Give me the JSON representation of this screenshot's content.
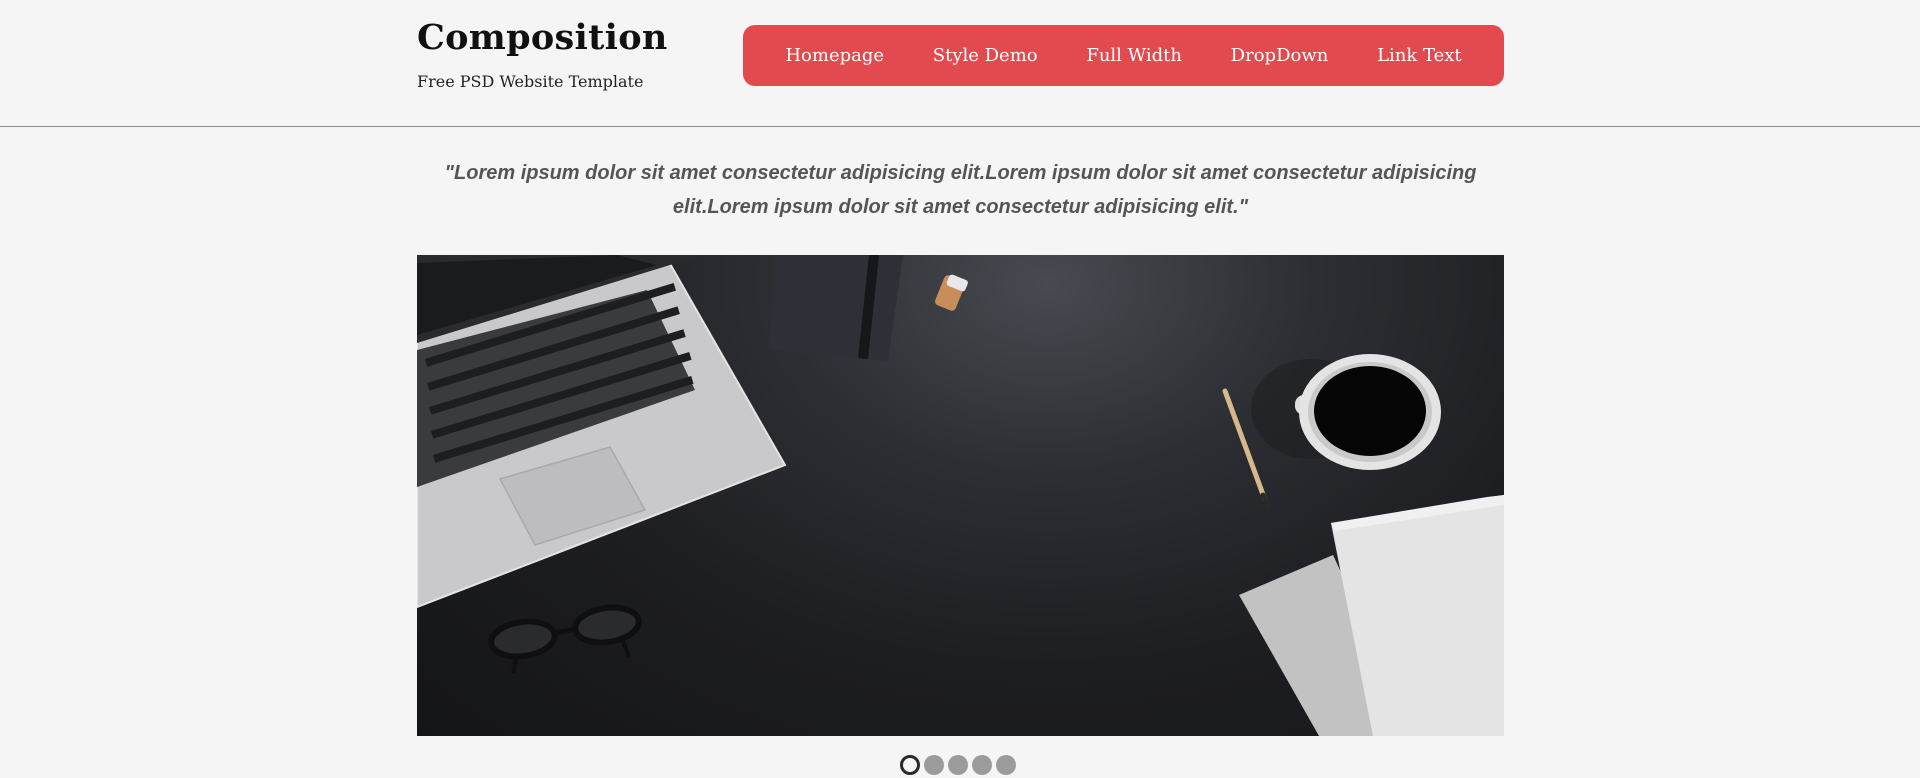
{
  "header": {
    "title": "Composition",
    "tagline": "Free PSD Website Template"
  },
  "nav": {
    "items": [
      {
        "label": "Homepage"
      },
      {
        "label": "Style Demo"
      },
      {
        "label": "Full Width"
      },
      {
        "label": "DropDown"
      },
      {
        "label": "Link Text"
      }
    ],
    "color": "#e24a50"
  },
  "quote": {
    "text": "\"Lorem ipsum dolor sit amet consectetur adipisicing elit.Lorem ipsum dolor sit amet consectetur adipisicing elit.Lorem ipsum dolor sit amet consectetur adipisicing elit.\""
  },
  "slider": {
    "slide_count": 5,
    "active_slide": 1
  }
}
